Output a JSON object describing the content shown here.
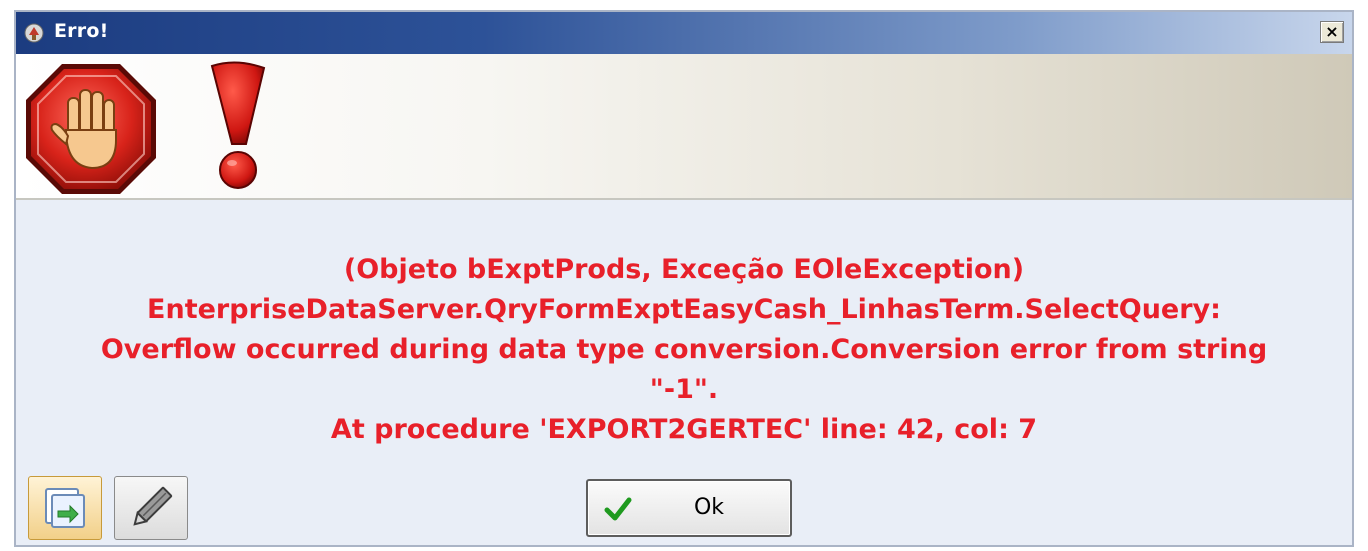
{
  "window": {
    "title": "Erro!",
    "close_label": "×"
  },
  "message": {
    "lines": [
      "(Objeto bExptProds, Exceção EOleException)",
      "EnterpriseDataServer.QryFormExptEasyCash_LinhasTerm.SelectQuery:",
      "Overflow occurred during data type conversion.Conversion error from string",
      "\"-1\".",
      "At procedure 'EXPORT2GERTEC' line: 42, col: 7"
    ],
    "color": "#e8202a"
  },
  "icons": {
    "app": "app-icon",
    "stop": "stop-hand-icon",
    "exclamation": "exclamation-icon",
    "details": "details-icon",
    "edit": "pencil-icon",
    "ok": "checkmark-icon"
  },
  "buttons": {
    "ok_label": "Ok"
  },
  "colors": {
    "titlebar": "#1c3c80",
    "body": "#e9eef7",
    "stop_red": "#cc1a14",
    "ok_check": "#1f9a1f"
  }
}
